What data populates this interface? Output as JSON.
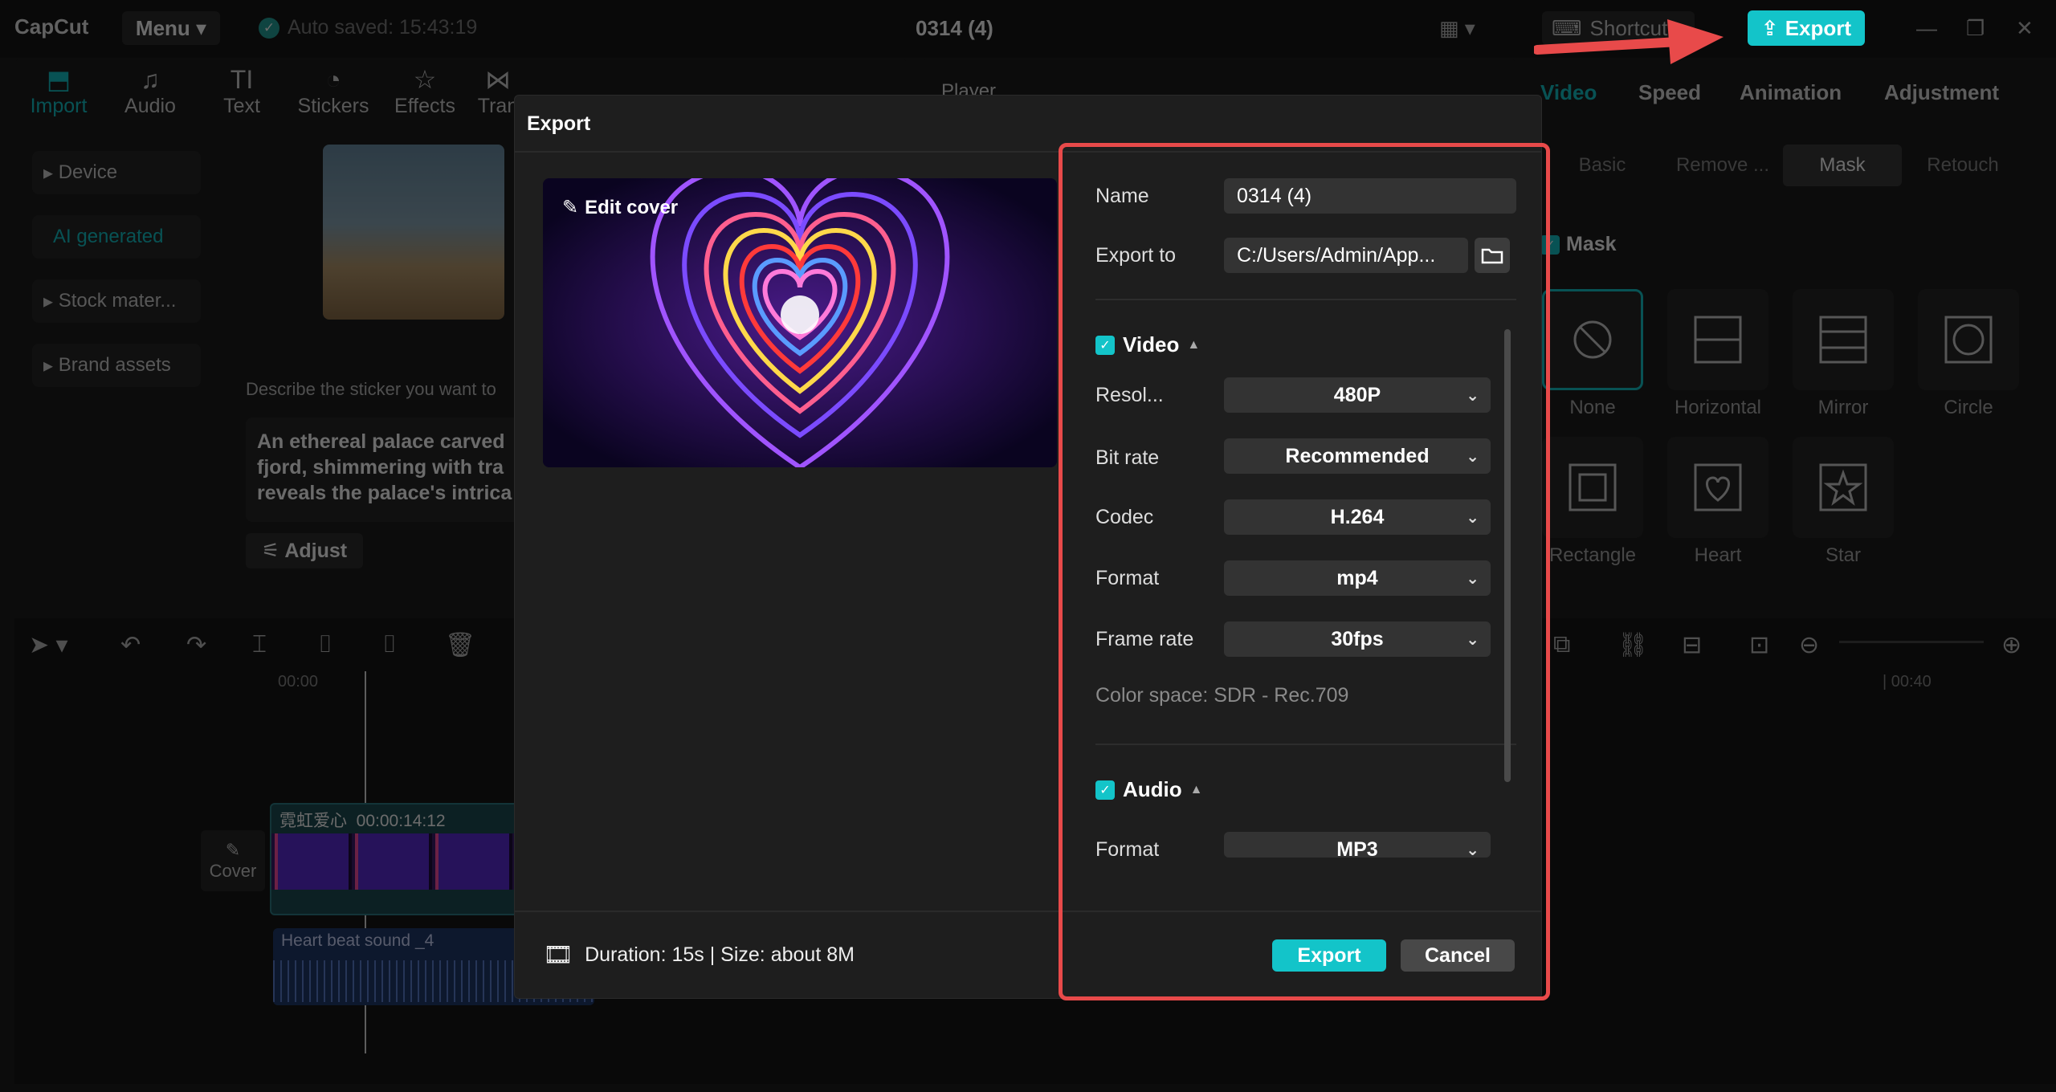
{
  "app": {
    "logo": "CapCut",
    "menu": "Menu",
    "autosave": "Auto saved: 15:43:19",
    "project_title": "0314 (4)",
    "shortcuts": "Shortcuts",
    "export": "Export"
  },
  "toolbar": {
    "tools": [
      {
        "label": "Import",
        "icon": "import-icon",
        "active": true
      },
      {
        "label": "Audio",
        "icon": "audio-icon"
      },
      {
        "label": "Text",
        "icon": "text-icon"
      },
      {
        "label": "Stickers",
        "icon": "stickers-icon"
      },
      {
        "label": "Effects",
        "icon": "effects-icon"
      },
      {
        "label": "Tran",
        "icon": "transitions-icon"
      }
    ]
  },
  "sidebar": {
    "items": [
      "Device",
      "AI generated",
      "Stock mater...",
      "Brand assets"
    ]
  },
  "sticker": {
    "describe": "Describe the sticker you want to",
    "prompt": "An ethereal palace carved fjord, shimmering with tra reveals the palace's intrica",
    "adjust": "Adjust"
  },
  "player": {
    "label": "Player"
  },
  "right_panel": {
    "tabs": [
      "Video",
      "Speed",
      "Animation",
      "Adjustment"
    ],
    "subtabs": [
      "Basic",
      "Remove ...",
      "Mask",
      "Retouch"
    ],
    "mask_label": "Mask",
    "masks": [
      "None",
      "Horizontal",
      "Mirror",
      "Circle",
      "Rectangle",
      "Heart",
      "Star"
    ]
  },
  "timeline": {
    "ruler_start": "00:00",
    "ruler_end": "| 00:40",
    "video_clip_title": "霓虹爱心",
    "video_clip_duration": "00:00:14:12",
    "audio_clip_title": "Heart beat sound _4",
    "cover": "Cover"
  },
  "dialog": {
    "title": "Export",
    "edit_cover": "Edit cover",
    "name_label": "Name",
    "name_value": "0314 (4)",
    "export_to_label": "Export to",
    "export_to_value": "C:/Users/Admin/App...",
    "video_section": "Video",
    "resolution_label": "Resol...",
    "resolution_value": "480P",
    "bitrate_label": "Bit rate",
    "bitrate_value": "Recommended",
    "codec_label": "Codec",
    "codec_value": "H.264",
    "format_label": "Format",
    "format_value": "mp4",
    "framerate_label": "Frame rate",
    "framerate_value": "30fps",
    "color_space": "Color space: SDR - Rec.709",
    "audio_section": "Audio",
    "audio_format_label": "Format",
    "audio_format_value": "MP3",
    "duration": "Duration: 15s | Size: about 8M",
    "export_button": "Export",
    "cancel_button": "Cancel"
  },
  "colors": {
    "accent": "#13c4c9",
    "highlight": "#e84a4a"
  }
}
